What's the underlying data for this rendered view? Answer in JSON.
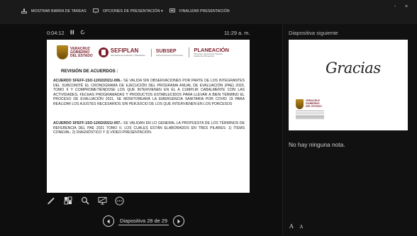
{
  "toolbar": {
    "show_taskbar": "MOSTRAR BARRA DE TAREAS",
    "presentation_options": "OPCIONES DE PRESENTACIÓN ▾",
    "end_presentation": "FINALIZAR PRESENTACIÓN",
    "window_controls": [
      "-",
      "×"
    ]
  },
  "presenter": {
    "timer": "0:04:12",
    "clock": "11:29 a. m.",
    "slide_counter": "Diapositiva 28 de 29",
    "next_label": "Diapositiva siguiente",
    "notes": "No hay ninguna nota.",
    "font_increase": "A",
    "font_decrease": "A"
  },
  "slide": {
    "logo_veracruz": [
      "VERACRUZ",
      "GOBIERNO",
      "DEL ESTADO"
    ],
    "logo_sefiplan": "SEFIPLAN",
    "logo_sefiplan_sub": "Secretaría de Finanzas y Planeación",
    "logo_subsep": "SUBSEP",
    "logo_subsep_sub": "Subsecretaría de Planeación",
    "logo_planeacion": "PLANEACIÓN",
    "logo_planeacion_sub": [
      "Dirección General del Sistema",
      "Estatal de Planeación"
    ],
    "heading": "REVISIÓN DE ACUERDOS :",
    "agreement1_code": "ACUERDO SFEFF-1SO-12/02/2021/-006.-",
    "agreement1_text": " SE VALIDA SIN OBSERVACIONES POR PARTE DE LOS INTEGRANTES DEL SUBCOMITÉ EL CRONOGRAMA DE EJECUCIÓN DEL PROGRAMA ANUAL DE EVALUACIÓN (PAE) 2020, TOMO II Y COMPROMETIÉNDOSE LOS QUE INTERVIENEN EN ÉL A CUMPLIR CABALMENTE CON LAS ACTIVIDADES, FECHAS PROGRAMADAS Y PRODUCTOS ESTABLECIDOS PARA LLEVAR A BIEN TÉRMINO EL PROCESO DE EVALUACIÓN 2021, SE MONITOREARÁ LA EMERGENCIA SANITARIA POR COVID 19 PARA REALIZAR LOS AJUSTES NECESARIOS SIN PERJUICIO DE LOS QUE INTERVIENEN EN LOS PORCESOS",
    "agreement2_code": "ACUERDO SFEFF-1SO-12/02/2021/-007.-",
    "agreement2_text": " SE VALIDAN EN LO GENERAL LA PROPUESTA DE LOS TÉRMINOS DE REFERENCIA DEL PAE 2021 TOMO II, LOS CUALES ESTÁN ELABORADOS EN TRES PILARES: 1) ÍTEMS CONEVAL; 2) DIAGNÓSTICO Y 3) VIDEO-PRESENTACIÓN."
  },
  "next_slide": {
    "title": "Gracias",
    "logo": [
      "VERACRUZ",
      "GOBIERNO",
      "DEL ESTADO"
    ]
  },
  "icons": [
    "taskbar-icon",
    "monitor-icon",
    "presentation-icon",
    "pause-icon",
    "reset-icon",
    "pen-icon",
    "slides-grid-icon",
    "zoom-icon",
    "screen-icon",
    "more-icon",
    "prev-icon",
    "next-icon"
  ]
}
